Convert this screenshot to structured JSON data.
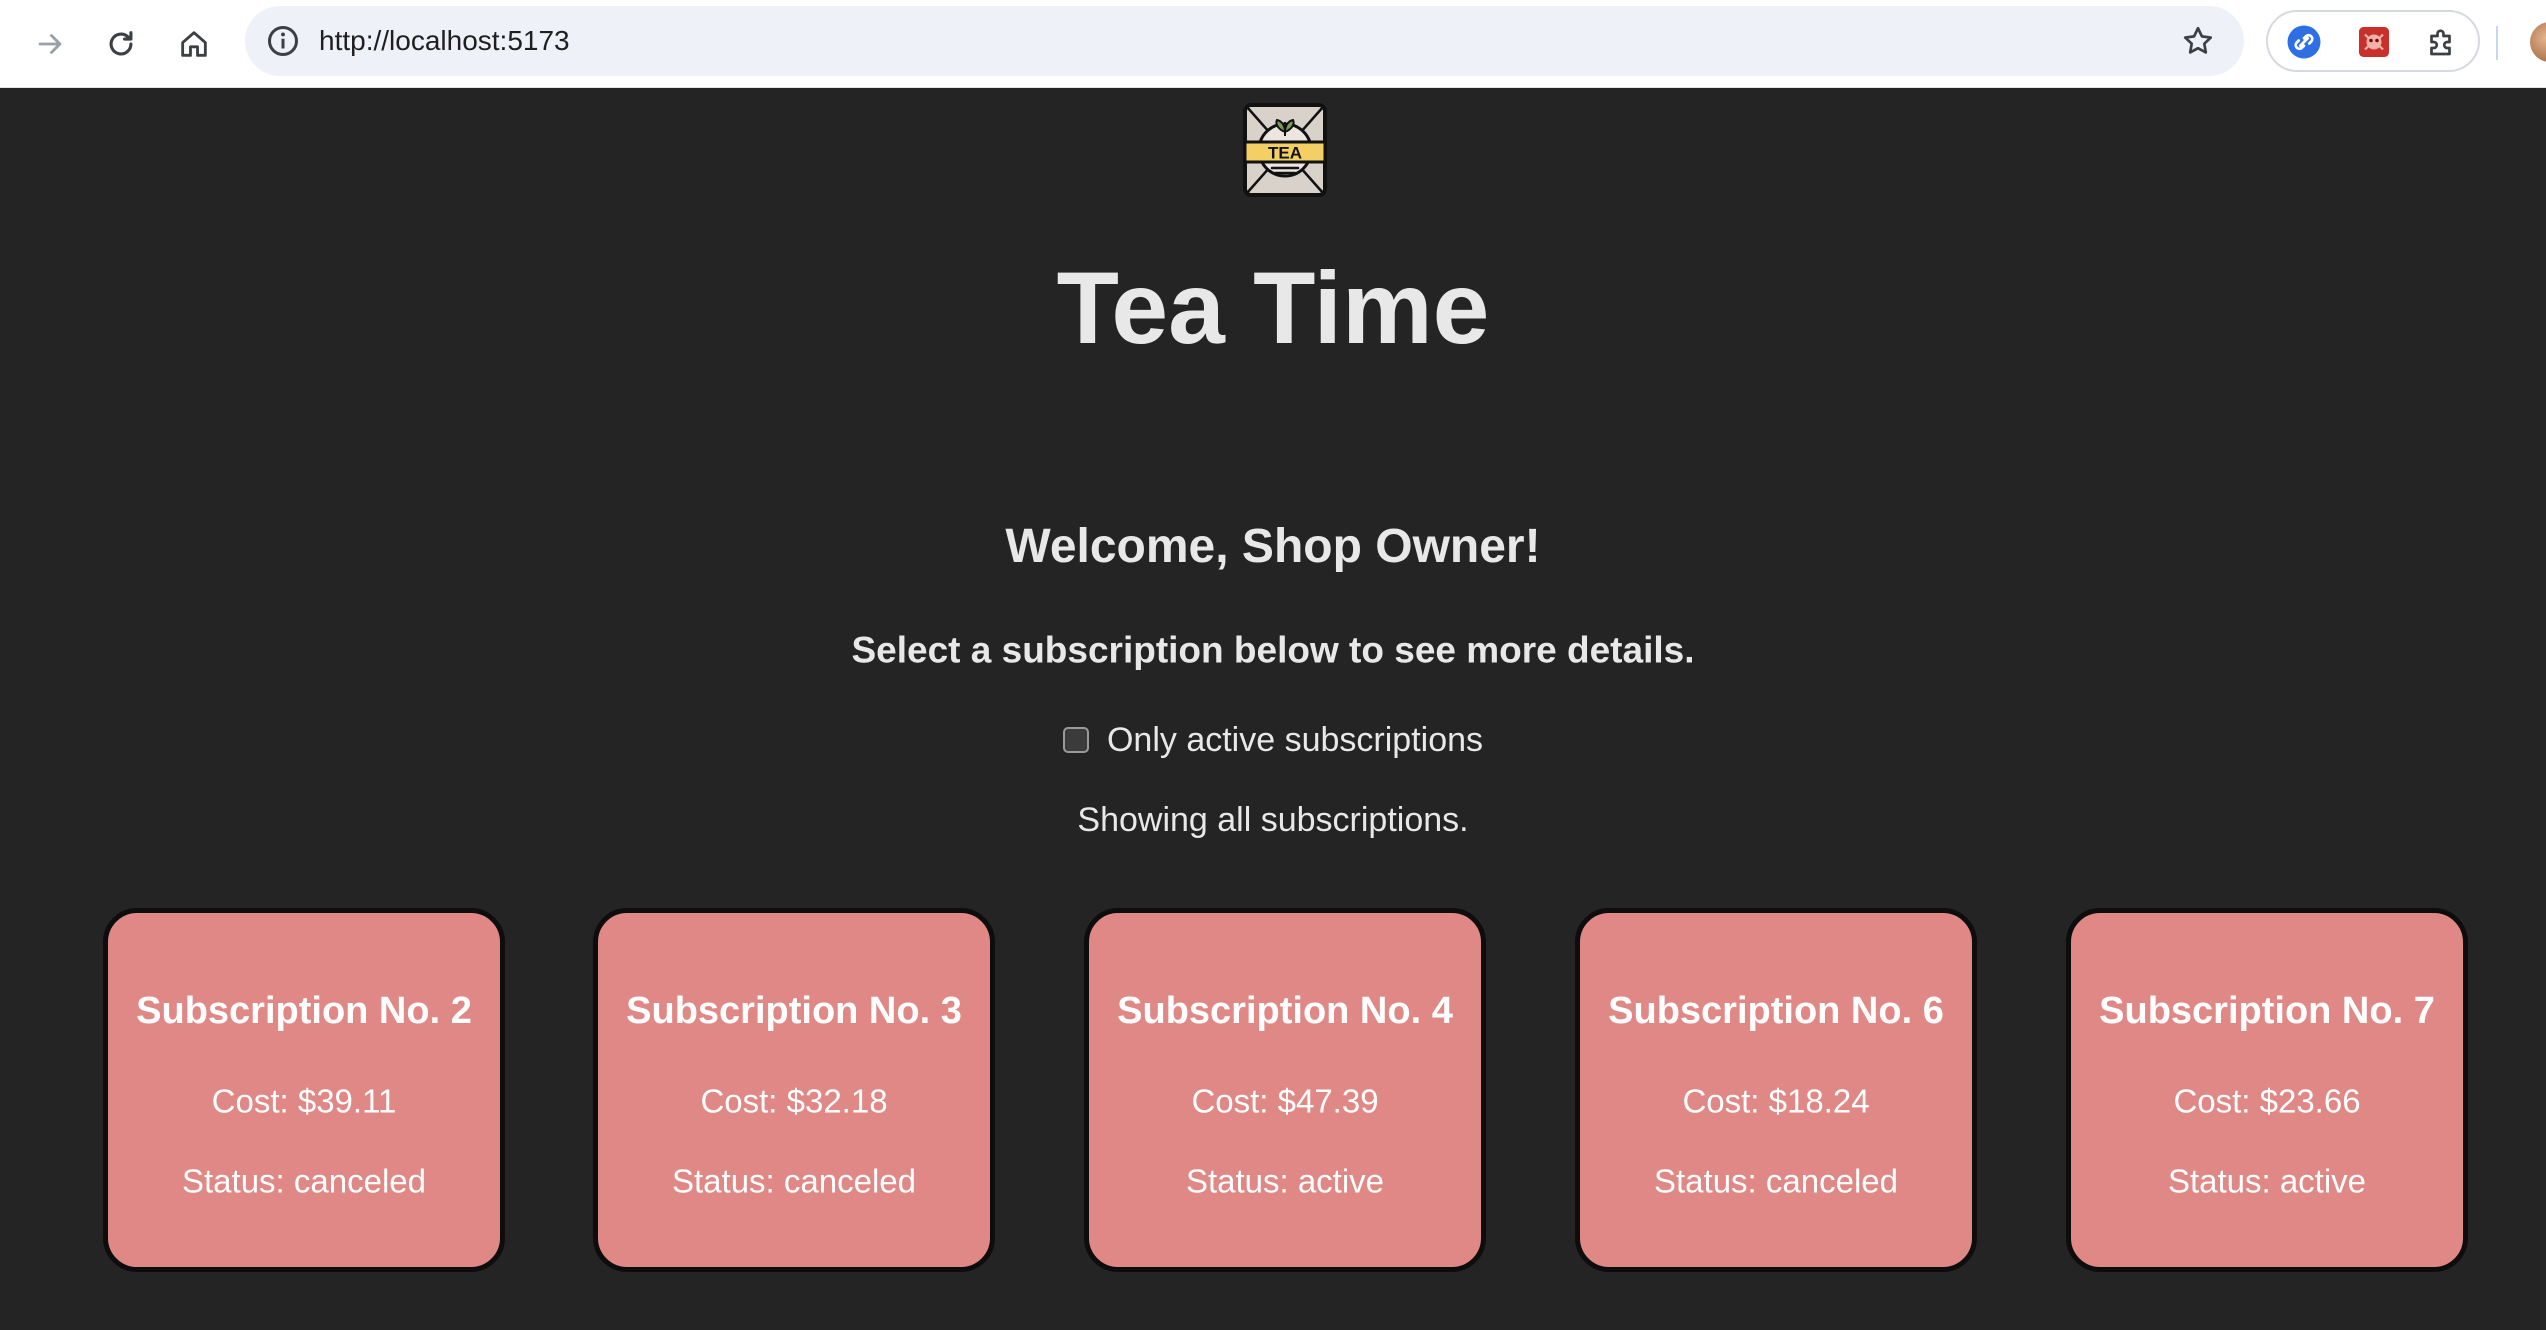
{
  "browser": {
    "url": "http://localhost:5173",
    "icons": {
      "forward": "arrow-forward-icon",
      "reload": "reload-icon",
      "home": "home-icon",
      "site_info": "info-icon",
      "bookmark": "star-icon",
      "extension_1": "link-extension-icon",
      "extension_2": "bug-extension-icon",
      "extensions_menu": "puzzle-icon"
    }
  },
  "app": {
    "logo_text": "TEA",
    "title": "Tea Time",
    "welcome": "Welcome, Shop Owner!",
    "instruction": "Select a subscription below to see more details.",
    "filter": {
      "label": "Only active subscriptions",
      "checked": false
    },
    "showing_text": "Showing all subscriptions.",
    "colors": {
      "background": "#242424",
      "card": "#e08886",
      "card_border": "#0d0d0d",
      "text": "#e8e8e8"
    }
  },
  "subscriptions": [
    {
      "title": "Subscription No. 2",
      "cost": "Cost: $39.11",
      "status": "Status: canceled"
    },
    {
      "title": "Subscription No. 3",
      "cost": "Cost: $32.18",
      "status": "Status: canceled"
    },
    {
      "title": "Subscription No. 4",
      "cost": "Cost: $47.39",
      "status": "Status: active"
    },
    {
      "title": "Subscription No. 6",
      "cost": "Cost: $18.24",
      "status": "Status: canceled"
    },
    {
      "title": "Subscription No. 7",
      "cost": "Cost: $23.66",
      "status": "Status: active"
    }
  ]
}
